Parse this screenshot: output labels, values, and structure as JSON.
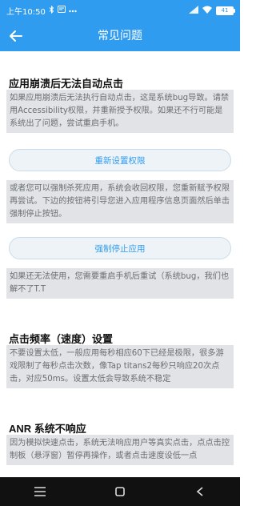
{
  "status_bar": {
    "time": "上午10:50",
    "icons": [
      "bluetooth-icon",
      "notification-icon",
      "more-dots-icon"
    ],
    "right_icons": [
      "signal-icon",
      "wifi-icon"
    ],
    "battery": "41"
  },
  "app_bar": {
    "title": "常见问题",
    "back_icon": "back-arrow-icon"
  },
  "sections": [
    {
      "title": "应用崩溃后无法自动点击",
      "desc": "如果应用崩溃后无法执行自动点击，这是系统bug导致。请禁用Accessibility权限，并重新授予权限。如果还不行可能是系统出了问题，尝试重启手机。",
      "button": "重新设置权限"
    },
    {
      "desc": "或者您可以强制杀死应用，系统会收回权限，您重新赋予权限再尝试。下边的按钮将引导您进入应用程序信息页面然后单击强制停止按钮。",
      "button": "强制停止应用"
    },
    {
      "desc": "如果还无法使用，您需要重启手机后重试（系统bug，我们也解不了T.T"
    },
    {
      "title": "点击频率（速度）设置",
      "desc": "不要设置太低，一般应用每秒相应60下已经是极限，很多游戏限制了每秒点击次数，像Tap titans2每秒只响应20次点击，对应50ms。设置太低会导致系统不稳定"
    },
    {
      "title": "ANR 系统不响应",
      "desc": "因为模拟快速点击，系统无法响应用户等真实点击，点点击控制板（悬浮窗）暂停再操作，或者点击速度设低一点"
    }
  ],
  "nav_bar": {
    "icons": [
      "menu-icon",
      "home-icon",
      "back-icon"
    ]
  }
}
